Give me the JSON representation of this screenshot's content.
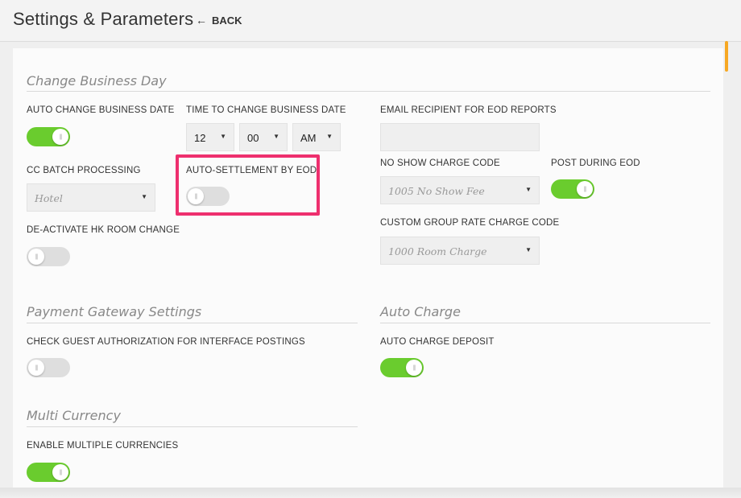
{
  "header": {
    "title": "Settings & Parameters",
    "back_label": "BACK"
  },
  "business_day": {
    "title": "Change Business Day",
    "auto_change_label": "AUTO CHANGE BUSINESS DATE",
    "auto_change_on": true,
    "time_label": "TIME TO CHANGE BUSINESS DATE",
    "time_hour": "12",
    "time_minute": "00",
    "time_ampm": "AM",
    "email_label": "EMAIL RECIPIENT FOR EOD REPORTS",
    "email_value": "",
    "cc_batch_label": "CC BATCH PROCESSING",
    "cc_batch_value": "Hotel",
    "auto_settlement_label": "AUTO-SETTLEMENT BY EOD",
    "auto_settlement_on": false,
    "no_show_label": "NO SHOW CHARGE CODE",
    "no_show_value": "1005 No Show Fee",
    "post_eod_label": "POST DURING EOD",
    "post_eod_on": true,
    "deactivate_hk_label": "DE-ACTIVATE HK ROOM CHANGE",
    "deactivate_hk_on": false,
    "group_rate_label": "CUSTOM GROUP RATE CHARGE CODE",
    "group_rate_value": "1000 Room Charge"
  },
  "payment_gateway": {
    "title": "Payment Gateway Settings",
    "check_auth_label": "CHECK GUEST AUTHORIZATION FOR INTERFACE POSTINGS",
    "check_auth_on": false
  },
  "auto_charge": {
    "title": "Auto Charge",
    "deposit_label": "AUTO CHARGE DEPOSIT",
    "deposit_on": true
  },
  "multi_currency": {
    "title": "Multi Currency",
    "enable_label": "ENABLE MULTIPLE CURRENCIES",
    "enable_on": true
  },
  "colors": {
    "toggle_on": "#6acc2e",
    "toggle_off": "#dedede",
    "highlight": "#ee2f6e",
    "scroll_accent": "#f7a823"
  },
  "icons": {
    "back": "back-arrow-icon",
    "caret": "caret-down-icon",
    "grip": "grip-icon"
  }
}
